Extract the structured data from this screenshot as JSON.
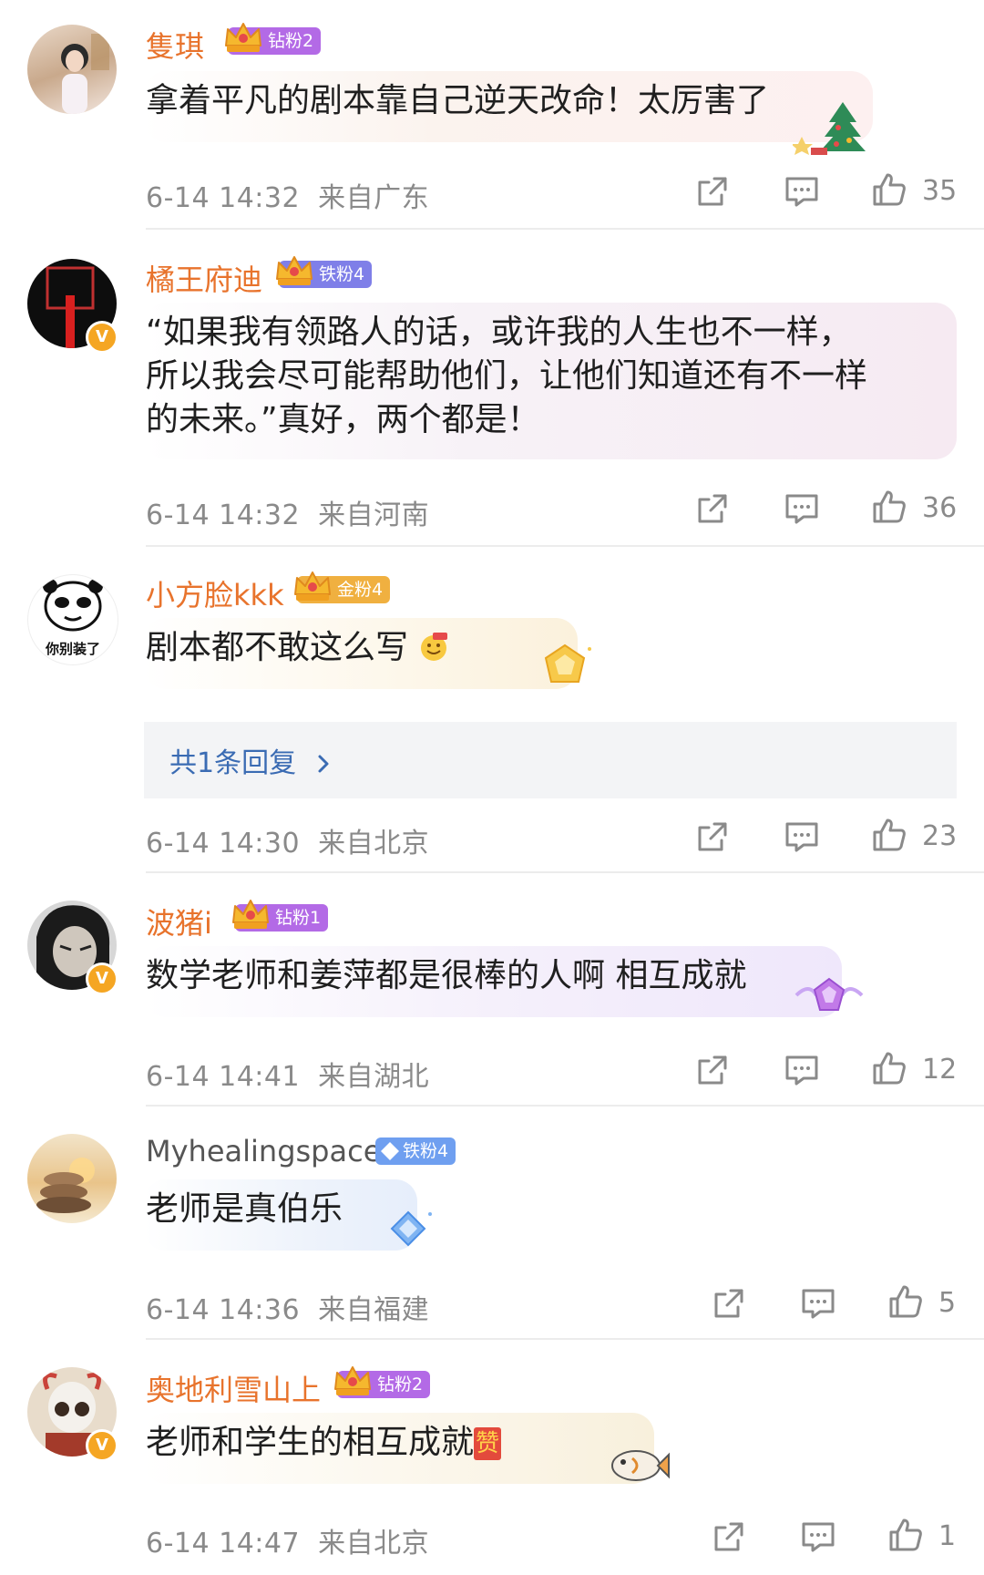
{
  "comments": [
    {
      "username": "隻琪",
      "badge": "钻粉2",
      "text": "拿着平凡的剧本靠自己逆天改命！太厉害了",
      "time": "6-14 14:32",
      "location": "来自广东",
      "likes": "35"
    },
    {
      "username": "橘王府迪",
      "badge": "铁粉4",
      "text_lines": [
        "“如果我有领路人的话，或许我的人生也不一样，",
        "所以我会尽可能帮助他们，让他们知道还有不一样",
        "的未来。”真好，两个都是！"
      ],
      "time": "6-14 14:32",
      "location": "来自河南",
      "likes": "36"
    },
    {
      "username": "小方脸kkk",
      "badge": "金粉4",
      "avatar_caption": "你别装了",
      "text": "剧本都不敢这么写",
      "replies_label": "共1条回复",
      "time": "6-14 14:30",
      "location": "来自北京",
      "likes": "23"
    },
    {
      "username": "波猪i",
      "badge": "钻粉1",
      "text": "数学老师和姜萍都是很棒的人啊 相互成就",
      "time": "6-14 14:41",
      "location": "来自湖北",
      "likes": "12"
    },
    {
      "username": "Myhealingspace",
      "badge": "铁粉4",
      "text": "老师是真伯乐",
      "time": "6-14 14:36",
      "location": "来自福建",
      "likes": "5"
    },
    {
      "username": "奥地利雪山上",
      "badge": "钻粉2",
      "text": "老师和学生的相互成就",
      "emoji_text": "赞",
      "time": "6-14 14:47",
      "location": "来自北京",
      "likes": "1"
    }
  ],
  "colors": {
    "username": "#e8732c",
    "meta": "#8a8a8a",
    "reply_link": "#3a6bb3",
    "badge_diamond": "#b36ae6",
    "badge_iron": "#7f7fe8",
    "badge_gold": "#f0b040",
    "verified": "#f5a623"
  },
  "icons": [
    "share-icon",
    "comment-icon",
    "like-icon",
    "chevron-right-icon",
    "verified-icon",
    "crown-icon"
  ]
}
